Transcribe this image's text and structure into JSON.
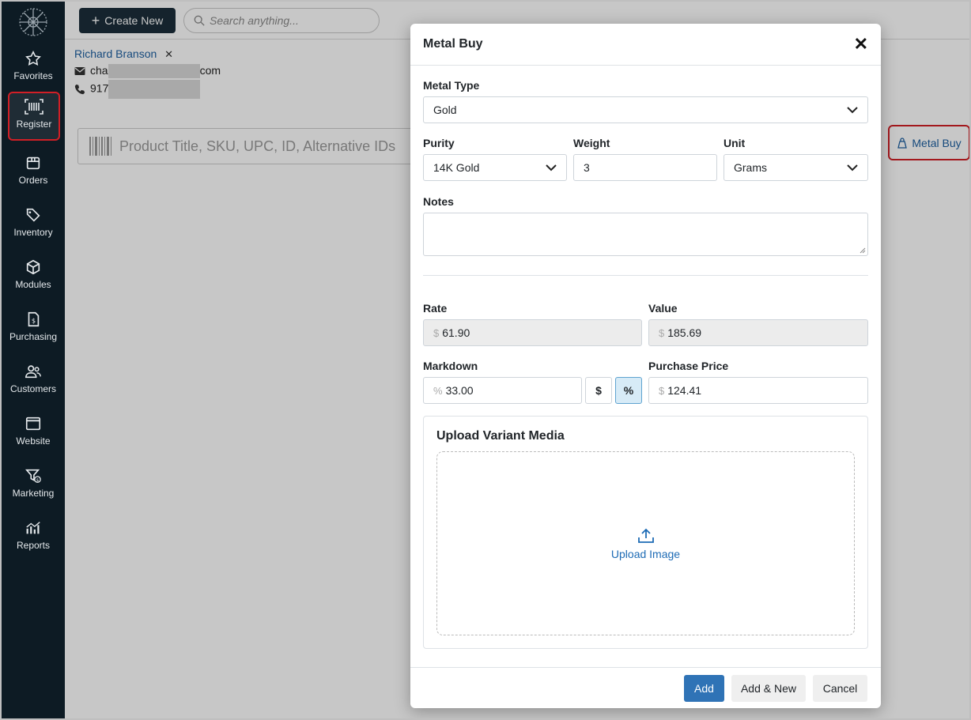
{
  "sidebar": {
    "items": [
      {
        "label": "Favorites",
        "icon": "star-icon"
      },
      {
        "label": "Register",
        "icon": "barcode-icon"
      },
      {
        "label": "Orders",
        "icon": "box-icon"
      },
      {
        "label": "Inventory",
        "icon": "tags-icon"
      },
      {
        "label": "Modules",
        "icon": "cube-icon"
      },
      {
        "label": "Purchasing",
        "icon": "invoice-icon"
      },
      {
        "label": "Customers",
        "icon": "users-icon"
      },
      {
        "label": "Website",
        "icon": "window-icon"
      },
      {
        "label": "Marketing",
        "icon": "funnel-icon"
      },
      {
        "label": "Reports",
        "icon": "chart-icon"
      }
    ],
    "active": "Register"
  },
  "topbar": {
    "create_label": "Create New",
    "search_placeholder": "Search anything..."
  },
  "customer": {
    "name": "Richard Branson",
    "remove_glyph": "✕",
    "email_prefix": "cha",
    "email_suffix": "com",
    "phone_prefix": "917"
  },
  "product_search": {
    "placeholder": "Product Title, SKU, UPC, ID, Alternative IDs"
  },
  "metal_buy_link": {
    "label": "Metal Buy"
  },
  "modal": {
    "title": "Metal Buy",
    "close_glyph": "✕",
    "metal_type": {
      "label": "Metal Type",
      "value": "Gold"
    },
    "purity": {
      "label": "Purity",
      "value": "14K Gold"
    },
    "weight": {
      "label": "Weight",
      "value": "3"
    },
    "unit": {
      "label": "Unit",
      "value": "Grams"
    },
    "notes": {
      "label": "Notes",
      "value": ""
    },
    "rate": {
      "label": "Rate",
      "prefix": "$",
      "value": "61.90"
    },
    "value": {
      "label": "Value",
      "prefix": "$",
      "value": "185.69"
    },
    "markdown": {
      "label": "Markdown",
      "prefix": "%",
      "value": "33.00",
      "dollar_toggle": "$",
      "percent_toggle": "%",
      "selected": "percent"
    },
    "purchase_price": {
      "label": "Purchase Price",
      "prefix": "$",
      "value": "124.41"
    },
    "upload": {
      "title": "Upload Variant Media",
      "action": "Upload Image"
    },
    "buttons": {
      "add": "Add",
      "add_new": "Add & New",
      "cancel": "Cancel"
    }
  },
  "colors": {
    "sidebar_bg": "#0d1b24",
    "highlight": "#d11f26",
    "link": "#1d5fa0",
    "primary_button": "#2f73b6"
  }
}
